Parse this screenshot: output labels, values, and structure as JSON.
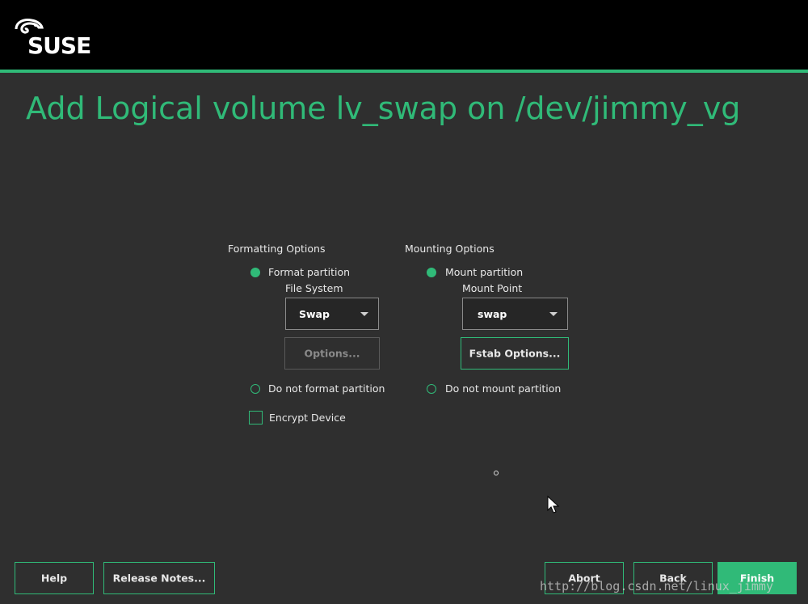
{
  "header": {
    "brand": "SUSE",
    "accent_color": "#30ba78",
    "logo_icon": "chameleon-logo-icon"
  },
  "page_title": "Add Logical volume lv_swap on /dev/jimmy_vg",
  "formatting": {
    "label": "Formatting Options",
    "format_partition": {
      "label": "Format partition",
      "selected": true
    },
    "file_system_label": "File System",
    "file_system_value": "Swap",
    "options_button": "Options...",
    "do_not_format": {
      "label": "Do not format partition",
      "selected": false
    },
    "encrypt_device": {
      "label": "Encrypt Device",
      "checked": false
    }
  },
  "mounting": {
    "label": "Mounting Options",
    "mount_partition": {
      "label": "Mount partition",
      "selected": true
    },
    "mount_point_label": "Mount Point",
    "mount_point_value": "swap",
    "fstab_button": "Fstab Options...",
    "do_not_mount": {
      "label": "Do not mount partition",
      "selected": false
    }
  },
  "footer": {
    "help": "Help",
    "release_notes": "Release Notes...",
    "abort": "Abort",
    "back": "Back",
    "finish": "Finish"
  },
  "watermark": "http://blog.csdn.net/linux_jimmy"
}
